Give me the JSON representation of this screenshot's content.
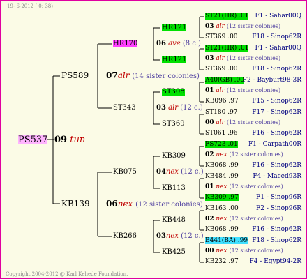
{
  "header": "19-  6-2012 (  0: 38)",
  "footer": "Copyright 2004-2012 @ Karl Kehede Foundation.",
  "colors": {
    "border": "#e000a0",
    "green": "#00e000",
    "cyan": "#40e0ff",
    "magenta": "#ff40ff",
    "pink": "#ffb4ff"
  },
  "g1": {
    "id": "PS537",
    "year": "09",
    "race": "tun"
  },
  "g2": [
    {
      "id": "PS589",
      "year": "07",
      "race": "alr",
      "note": "(14 sister colonies)"
    },
    {
      "id": "KB139",
      "year": "06",
      "race": "nex",
      "note": "(12 sister colonies)"
    }
  ],
  "g3": [
    {
      "id": "HR170",
      "year": "06",
      "race": "ave",
      "note": "(8 c.)"
    },
    {
      "id": "ST343",
      "year": "03",
      "race": "alr",
      "note": "(12 c.)"
    },
    {
      "id": "KB075",
      "year": "04",
      "race": "nex",
      "note": "(12 c.)"
    },
    {
      "id": "KB266",
      "year": "03",
      "race": "nex",
      "note": "(12 c.)"
    }
  ],
  "g4": [
    "HR121",
    "HR121",
    "ST308",
    "ST369",
    "KB309",
    "KB113",
    "KB448",
    "KB425"
  ],
  "g5": [
    {
      "left": "ST21(HR) .01",
      "hl": "g",
      "right": "F1 - Sahar00Q"
    },
    {
      "left": "03",
      "race": "alr",
      "note": "(12 sister colonies)"
    },
    {
      "left": "ST369 .00",
      "right": "F18 - Sinop62R"
    },
    {
      "left": "ST21(HR) .01",
      "hl": "g",
      "right": "F1 - Sahar00Q"
    },
    {
      "left": "03",
      "race": "alr",
      "note": "(12 sister colonies)"
    },
    {
      "left": "ST369 .00",
      "right": "F18 - Sinop62R"
    },
    {
      "left": "A40(GB) .00",
      "hl": "g",
      "right": "F2 - Bayburt98-3R"
    },
    {
      "left": "01",
      "race": "alr",
      "note": "(12 sister colonies)"
    },
    {
      "left": "KB096 .97",
      "right": "F15 - Sinop62R"
    },
    {
      "left": "ST180 .97",
      "right": "F17 - Sinop62R"
    },
    {
      "left": "00",
      "race": "alr",
      "note": "(12 sister colonies)"
    },
    {
      "left": "ST061 .96",
      "right": "F16 - Sinop62R"
    },
    {
      "left": "FS723 .01",
      "hl": "g",
      "right": "F1 - Carpath00R"
    },
    {
      "left": "02",
      "race": "nex",
      "note": "(12 sister colonies)"
    },
    {
      "left": "KB068 .99",
      "right": "F16 - Sinop62R"
    },
    {
      "left": "KB484 .99",
      "right": "F4 - Maced93R"
    },
    {
      "left": "01",
      "race": "nex",
      "note": "(12 sister colonies)"
    },
    {
      "left": "KB309 .97",
      "hl": "g",
      "right": "F1 - Sinop96R"
    },
    {
      "left": "KB163 .00",
      "right": "F2 - Sinop96R"
    },
    {
      "left": "02",
      "race": "nex",
      "note": "(12 sister colonies)"
    },
    {
      "left": "KB068 .99",
      "right": "F16 - Sinop62R"
    },
    {
      "left": "B441(BA) .99",
      "hl": "c",
      "right": "F18 - Sinop62R"
    },
    {
      "left": "00",
      "race": "nex",
      "note": "(12 sister colonies)"
    },
    {
      "left": "KB232 .97",
      "right": "F4 - Egypt94-2R"
    }
  ]
}
